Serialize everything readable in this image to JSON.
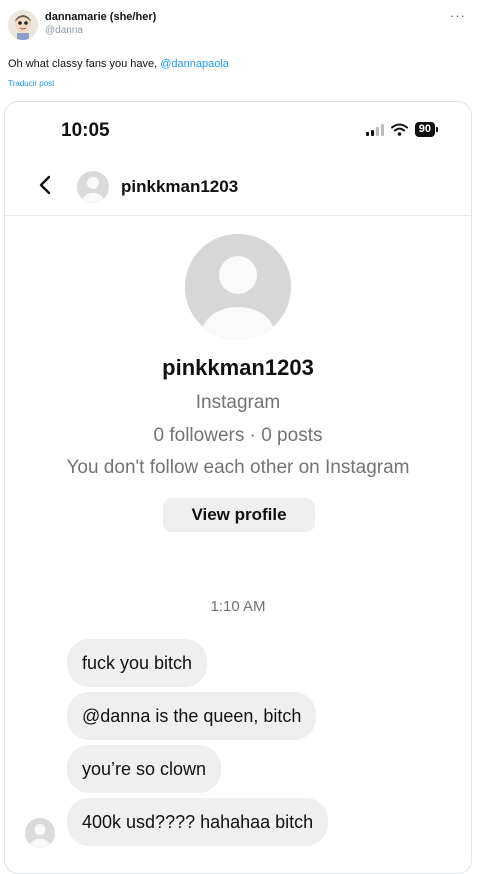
{
  "tweet": {
    "author_name": "dannamarie (she/her)",
    "author_handle": "@danna",
    "more_icon": "more-horizontal-icon",
    "text_prefix": "Oh what classy fans you have, ",
    "text_mention": "@dannapaola",
    "translate_label": "Traducir post"
  },
  "phone": {
    "status_time": "10:05",
    "signal_icon": "cellular-signal-icon",
    "wifi_icon": "wifi-icon",
    "battery_level": "90",
    "chat_username": "pinkkman1203",
    "back_icon": "chevron-left-icon"
  },
  "profile": {
    "username": "pinkkman1203",
    "platform": "Instagram",
    "stats": "0 followers · 0 posts",
    "relation": "You don't follow each other on Instagram",
    "view_profile_label": "View profile"
  },
  "messages": {
    "timestamp": "1:10 AM",
    "items": [
      "fuck you bitch",
      "@danna is the queen, bitch",
      "you’re so clown",
      "400k usd???? hahahaa bitch"
    ]
  },
  "colors": {
    "mention": "#1d9bf0",
    "bubble": "#efefef",
    "secondary_text": "#737373"
  }
}
